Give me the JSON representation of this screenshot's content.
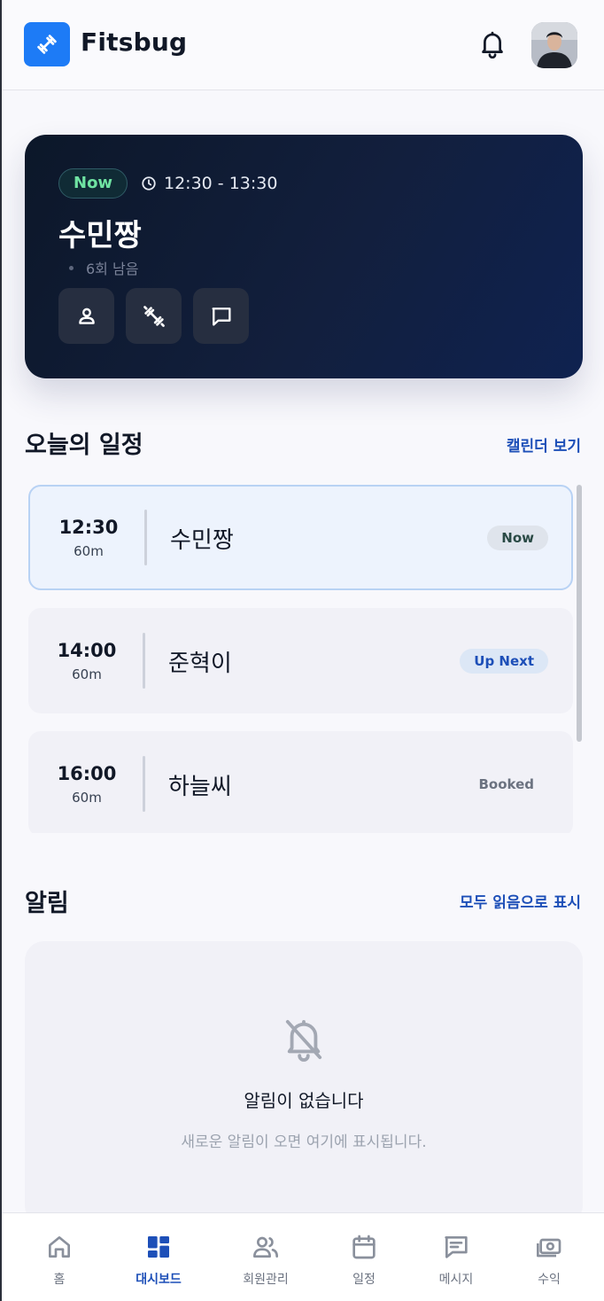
{
  "header": {
    "app_name": "Fitsbug"
  },
  "current_session": {
    "status": "Now",
    "time_range": "12:30 - 13:30",
    "member_name": "수민짱",
    "remaining": "6회 남음"
  },
  "schedule": {
    "title": "오늘의 일정",
    "link": "캘린더 보기",
    "items": [
      {
        "time": "12:30",
        "duration": "60m",
        "name": "수민짱",
        "status": "Now"
      },
      {
        "time": "14:00",
        "duration": "60m",
        "name": "준혁이",
        "status": "Up Next"
      },
      {
        "time": "16:00",
        "duration": "60m",
        "name": "하늘씨",
        "status": "Booked"
      }
    ]
  },
  "notifications": {
    "title": "알림",
    "link": "모두 읽음으로 표시",
    "empty_title": "알림이 없습니다",
    "empty_subtitle": "새로운 알림이 오면 여기에 표시됩니다."
  },
  "nav": {
    "items": [
      {
        "label": "홈",
        "icon": "home-icon"
      },
      {
        "label": "대시보드",
        "icon": "dashboard-icon"
      },
      {
        "label": "회원관리",
        "icon": "members-icon"
      },
      {
        "label": "일정",
        "icon": "calendar-icon"
      },
      {
        "label": "메시지",
        "icon": "message-icon"
      },
      {
        "label": "수익",
        "icon": "revenue-icon"
      }
    ],
    "active": "대시보드"
  },
  "colors": {
    "accent": "#1d4fb8",
    "brand": "#1d7bf6",
    "hero_bg": "#0f1b33",
    "now_green": "#6fe3a2"
  }
}
